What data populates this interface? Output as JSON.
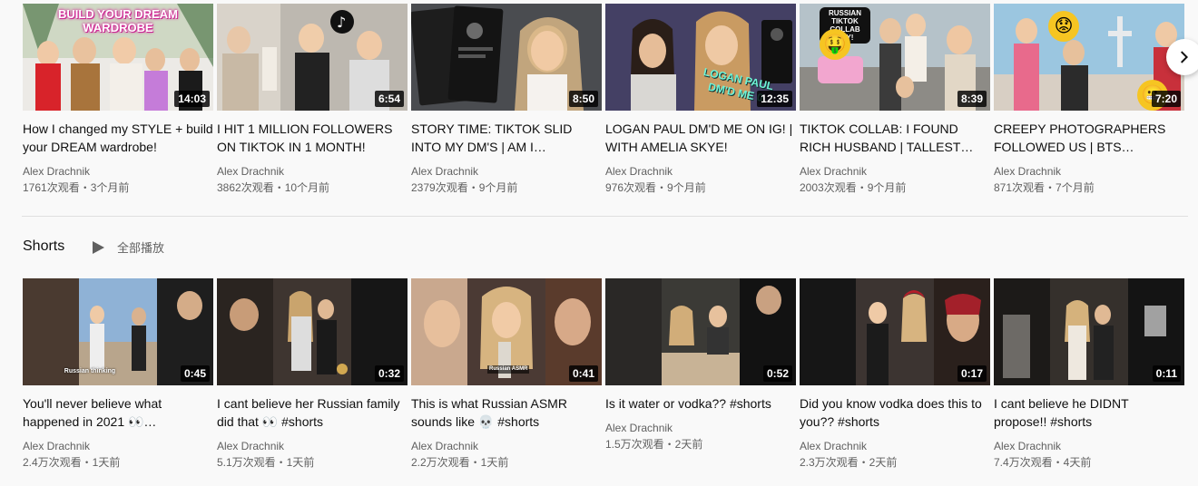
{
  "videos": [
    {
      "title": "How I changed my STYLE + build your DREAM wardrobe!",
      "channel": "Alex Drachnik",
      "meta": "1761次观看・3个月前",
      "duration": "14:03",
      "overlay": "BUILD YOUR DREAM WARDROBE"
    },
    {
      "title": "I HIT 1 MILLION FOLLOWERS ON TIKTOK IN 1 MONTH!",
      "channel": "Alex Drachnik",
      "meta": "3862次观看・10个月前",
      "duration": "6:54"
    },
    {
      "title": "STORY TIME: TIKTOK SLID INTO MY DM'S | AM I…",
      "channel": "Alex Drachnik",
      "meta": "2379次观看・9个月前",
      "duration": "8:50"
    },
    {
      "title": "LOGAN PAUL DM'D ME ON IG! | WITH AMELIA SKYE!",
      "channel": "Alex Drachnik",
      "meta": "976次观看・9个月前",
      "duration": "12:35",
      "overlay": "LOGAN PAUL DM'D ME 0"
    },
    {
      "title": "TIKTOK COLLAB: I FOUND RICH HUSBAND | TALLEST…",
      "channel": "Alex Drachnik",
      "meta": "2003次观看・9个月前",
      "duration": "8:39",
      "overlay": "RUSSIAN TIKTOK COLLAB DAY!"
    },
    {
      "title": "CREEPY PHOTOGRAPHERS FOLLOWED US | BTS…",
      "channel": "Alex Drachnik",
      "meta": "871次观看・7个月前",
      "duration": "7:20"
    }
  ],
  "shelf": {
    "title": "Shorts",
    "play_all": "全部播放"
  },
  "shorts": [
    {
      "title": "You'll never believe what happened in 2021 👀…",
      "channel": "Alex Drachnik",
      "meta": "2.4万次观看・1天前",
      "duration": "0:45",
      "overlay": "Russian thinking"
    },
    {
      "title": "I cant believe her Russian family did that 👀 #shorts",
      "channel": "Alex Drachnik",
      "meta": "5.1万次观看・1天前",
      "duration": "0:32"
    },
    {
      "title": "This is what Russian ASMR sounds like 💀 #shorts",
      "channel": "Alex Drachnik",
      "meta": "2.2万次观看・1天前",
      "duration": "0:41",
      "overlay": "Russian ASMR"
    },
    {
      "title": "Is it water or vodka?? #shorts",
      "channel": "Alex Drachnik",
      "meta": "1.5万次观看・2天前",
      "duration": "0:52"
    },
    {
      "title": "Did you know vodka does this to you?? #shorts",
      "channel": "Alex Drachnik",
      "meta": "2.3万次观看・2天前",
      "duration": "0:17"
    },
    {
      "title": "I cant believe he DIDNT propose!! #shorts",
      "channel": "Alex Drachnik",
      "meta": "7.4万次观看・4天前",
      "duration": "0:11"
    }
  ],
  "icons": {
    "next": "chevron-right-icon",
    "play_all": "play-icon"
  },
  "colors": {
    "background": "#f9f9f9",
    "title_text": "#0f0f0f",
    "meta_text": "#606060",
    "duration_bg": "#000000"
  }
}
